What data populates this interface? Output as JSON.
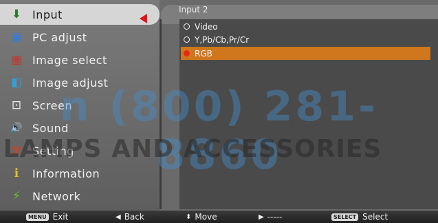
{
  "menu": {
    "items": [
      {
        "label": "Input",
        "icon": "input-icon",
        "glyph": "⬇"
      },
      {
        "label": "PC adjust",
        "icon": "pc-adjust-icon",
        "glyph": "▣"
      },
      {
        "label": "Image select",
        "icon": "image-select-icon",
        "glyph": "▦"
      },
      {
        "label": "Image adjust",
        "icon": "image-adjust-icon",
        "glyph": "◧"
      },
      {
        "label": "Screen",
        "icon": "screen-icon",
        "glyph": "⊡"
      },
      {
        "label": "Sound",
        "icon": "sound-icon",
        "glyph": "🔊"
      },
      {
        "label": "Setting",
        "icon": "setting-icon",
        "glyph": "⚒"
      },
      {
        "label": "Information",
        "icon": "information-icon",
        "glyph": "ℹ"
      },
      {
        "label": "Network",
        "icon": "network-icon",
        "glyph": "⚡"
      }
    ],
    "selected_index": 0
  },
  "panel": {
    "title": "Input 2",
    "options": [
      {
        "label": "Video",
        "selected": false
      },
      {
        "label": "Y,Pb/Cb,Pr/Cr",
        "selected": false
      },
      {
        "label": "RGB",
        "selected": true
      }
    ]
  },
  "footer": {
    "menu_key": "MENU",
    "exit_label": "Exit",
    "back_label": "Back",
    "move_label": "Move",
    "next_label": "-----",
    "select_key": "SELECT",
    "select_label": "Select"
  },
  "watermark": {
    "phone": "n (800) 281-8860",
    "brand": "LAMPS AND ACCESSORIES"
  },
  "colors": {
    "selected_option": "#d0761c",
    "selected_marker": "#e52a14",
    "menu_arrow": "#e0121a"
  }
}
